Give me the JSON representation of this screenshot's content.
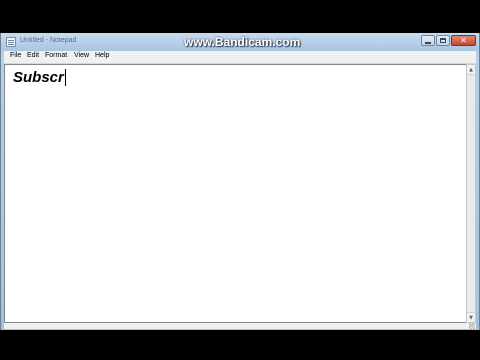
{
  "window": {
    "title": "Untitled - Notepad",
    "watermark": "www.Bandicam.com",
    "controls": {
      "minimize_icon": "minimize-icon",
      "maximize_icon": "maximize-icon",
      "close_icon": "close-icon",
      "close_glyph": "✕"
    }
  },
  "menu": {
    "file": "File",
    "edit": "Edit",
    "format": "Format",
    "view": "View",
    "help": "Help"
  },
  "editor": {
    "text": "Subscr"
  },
  "scrollbar": {
    "up": "▲",
    "down": "▼"
  },
  "colors": {
    "titlebar": "#b9d1ea",
    "close_button": "#c6452e",
    "editor_background": "#ffffff",
    "letterbox": "#000000"
  }
}
